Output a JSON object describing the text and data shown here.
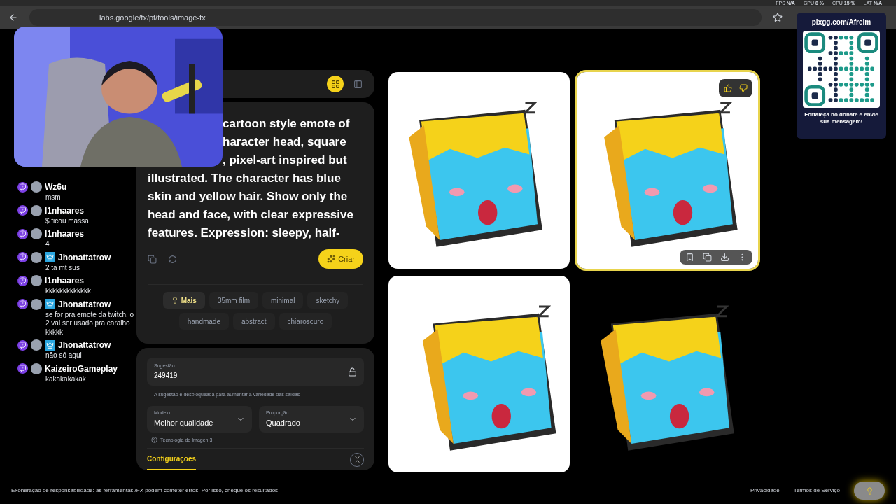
{
  "browser": {
    "url": "labs.google/fx/pt/tools/image-fx",
    "stats": [
      {
        "label": "FPS",
        "value": "N/A"
      },
      {
        "label": "GPU",
        "value": "8 %"
      },
      {
        "label": "CPU",
        "value": "15 %"
      },
      {
        "label": "LAT",
        "value": "N/A"
      }
    ]
  },
  "chat": [
    {
      "user": "Wz6u",
      "text": "msm",
      "subscriber": false
    },
    {
      "user": "l1nhaares",
      "text": "$ ficou massa",
      "subscriber": false
    },
    {
      "user": "l1nhaares",
      "text": "4",
      "subscriber": false
    },
    {
      "user": "Jhonattatrow",
      "text": "2 ta mt sus",
      "subscriber": true
    },
    {
      "user": "l1nhaares",
      "text": "kkkkkkkkkkkkk",
      "subscriber": false
    },
    {
      "user": "Jhonattatrow",
      "text": "se for pra emote da twitch, o 2 vai ser usado pra caralho kkkkk",
      "subscriber": true
    },
    {
      "user": "Jhonattatrow",
      "text": "não só aqui",
      "subscriber": true
    },
    {
      "user": "KaizeiroGameplay",
      "text": "kakakakakak",
      "subscriber": false
    }
  ],
  "view_toggle": [
    {
      "kind": "grid",
      "selected": true
    },
    {
      "kind": "single",
      "selected": false
    }
  ],
  "prompt": {
    "lines": [
      "cartoon style emote of",
      "haracter head, square",
      ", pixel-art inspired but",
      "illustrated. The character has blue",
      "skin and yellow hair. Show only the",
      "head and face, with clear expressive",
      "features. Expression: sleepy, half-"
    ],
    "create_button": "Criar"
  },
  "chips": [
    {
      "label": "Mais",
      "selected": true
    },
    {
      "label": "35mm film",
      "selected": false
    },
    {
      "label": "minimal",
      "selected": false
    },
    {
      "label": "sketchy",
      "selected": false
    },
    {
      "label": "handmade",
      "selected": false
    },
    {
      "label": "abstract",
      "selected": false
    },
    {
      "label": "chiaroscuro",
      "selected": false
    }
  ],
  "settings": {
    "seed": {
      "label": "Sugestão",
      "value": "249419"
    },
    "seed_hint": "A sugestão é desbloqueada para aumentar a variedade das saídas",
    "model": {
      "label": "Modelo",
      "value": "Melhor qualidade"
    },
    "ratio": {
      "label": "Proporção",
      "value": "Quadrado"
    },
    "tech_note": "Tecnologia do Imagen 3",
    "tab": {
      "label": "Configurações",
      "selected": true
    }
  },
  "images": [
    {
      "selected": false,
      "kind": "opaque"
    },
    {
      "selected": true,
      "kind": "opaque"
    },
    {
      "selected": false,
      "kind": "opaque"
    },
    {
      "selected": false,
      "kind": "transparent"
    }
  ],
  "footer": {
    "disclaimer": "Exoneração de responsabilidade: as ferramentas /FX podem cometer erros. Por isso, cheque os resultados",
    "links": [
      "Privacidade",
      "Termos de Serviço"
    ]
  },
  "donation": {
    "url": "pixgg.com/Afreim",
    "message": "Fortaleça no donate e envie sua mensagem!"
  }
}
